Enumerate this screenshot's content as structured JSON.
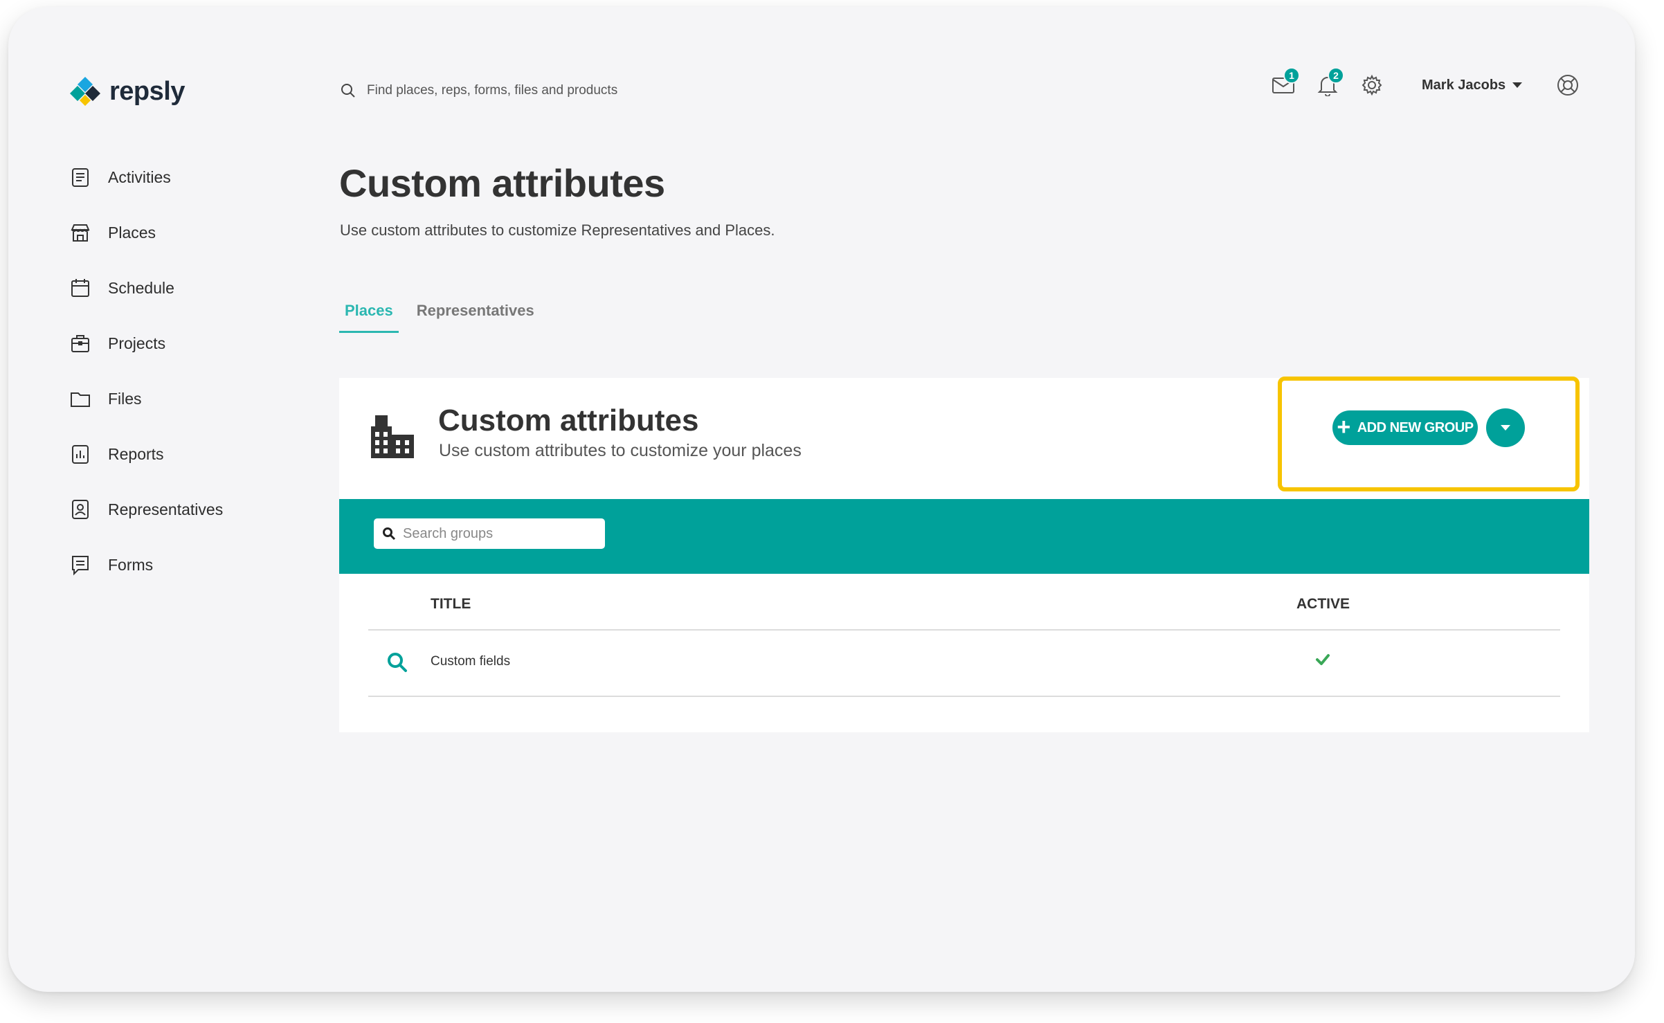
{
  "brand": {
    "name": "repsly"
  },
  "sidebar": {
    "items": [
      {
        "label": "Activities",
        "icon": "activities-icon"
      },
      {
        "label": "Places",
        "icon": "places-icon"
      },
      {
        "label": "Schedule",
        "icon": "calendar-icon"
      },
      {
        "label": "Projects",
        "icon": "briefcase-icon"
      },
      {
        "label": "Files",
        "icon": "folder-icon"
      },
      {
        "label": "Reports",
        "icon": "reports-icon"
      },
      {
        "label": "Representatives",
        "icon": "person-icon"
      },
      {
        "label": "Forms",
        "icon": "forms-icon"
      }
    ]
  },
  "header": {
    "search_placeholder": "Find places, reps, forms, files and products",
    "mail_badge": "1",
    "notifications_badge": "2",
    "user_name": "Mark Jacobs"
  },
  "page": {
    "title": "Custom attributes",
    "subtitle": "Use custom attributes to customize Representatives and Places."
  },
  "tabs": [
    {
      "label": "Places",
      "active": true
    },
    {
      "label": "Representatives",
      "active": false
    }
  ],
  "card": {
    "title": "Custom attributes",
    "description": "Use custom attributes to customize your places",
    "add_button_label": "ADD NEW GROUP",
    "search_placeholder": "Search groups"
  },
  "table": {
    "columns": [
      "TITLE",
      "ACTIVE"
    ],
    "rows": [
      {
        "title": "Custom fields",
        "active": true
      }
    ]
  },
  "colors": {
    "accent": "#00a19a",
    "tab_active": "#2bb7b1",
    "highlight": "#f7c400",
    "check": "#3aa757"
  }
}
